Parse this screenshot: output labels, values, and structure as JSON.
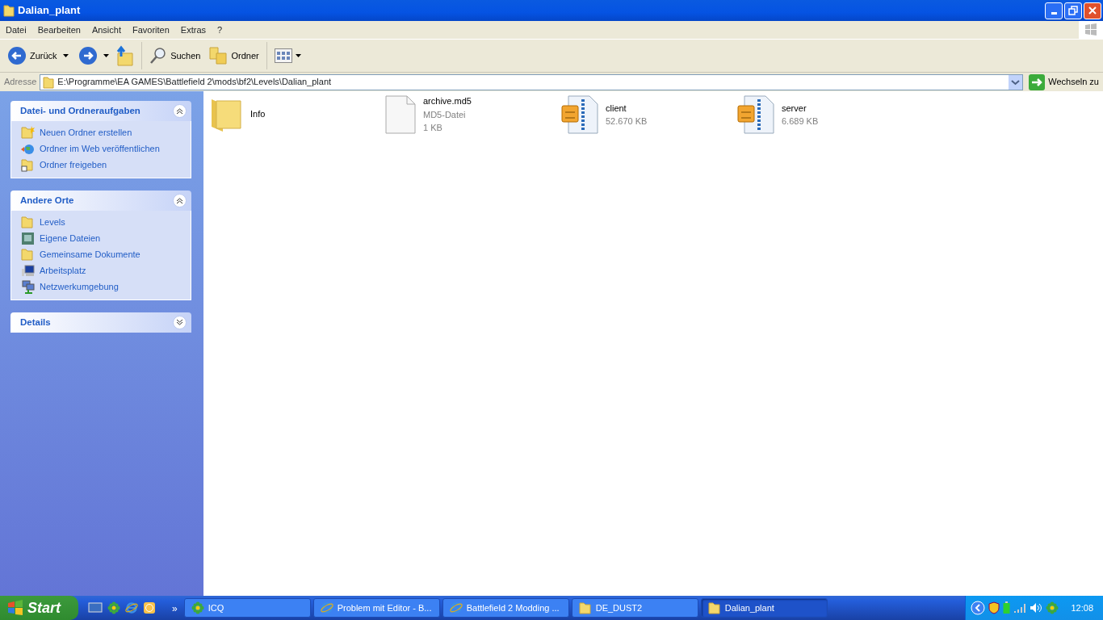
{
  "window": {
    "title": "Dalian_plant"
  },
  "menu": [
    "Datei",
    "Bearbeiten",
    "Ansicht",
    "Favoriten",
    "Extras",
    "?"
  ],
  "toolbar": {
    "back": "Zurück",
    "search": "Suchen",
    "folders": "Ordner"
  },
  "address": {
    "label": "Adresse",
    "value": "E:\\Programme\\EA GAMES\\Battlefield 2\\mods\\bf2\\Levels\\Dalian_plant",
    "go": "Wechseln zu"
  },
  "sidebar": [
    {
      "title": "Datei- und Ordneraufgaben",
      "expanded": true,
      "items": [
        "Neuen Ordner erstellen",
        "Ordner im Web veröffentlichen",
        "Ordner freigeben"
      ]
    },
    {
      "title": "Andere Orte",
      "expanded": true,
      "items": [
        "Levels",
        "Eigene Dateien",
        "Gemeinsame Dokumente",
        "Arbeitsplatz",
        "Netzwerkumgebung"
      ]
    },
    {
      "title": "Details",
      "expanded": false
    }
  ],
  "files": [
    {
      "kind": "folder",
      "name": "Info"
    },
    {
      "kind": "file",
      "name": "archive.md5",
      "type": "MD5-Datei",
      "size": "1 KB"
    },
    {
      "kind": "archive",
      "name": "client",
      "size": "52.670 KB"
    },
    {
      "kind": "archive",
      "name": "server",
      "size": "6.689 KB"
    }
  ],
  "taskbar": {
    "start": "Start",
    "more": "»",
    "buttons": [
      {
        "kind": "icq",
        "label": "ICQ",
        "selected": false
      },
      {
        "kind": "browser",
        "label": "Problem mit Editor - B...",
        "selected": false
      },
      {
        "kind": "browser",
        "label": "Battlefield 2 Modding ...",
        "selected": false
      },
      {
        "kind": "folder",
        "label": "DE_DUST2",
        "selected": false
      },
      {
        "kind": "folder",
        "label": "Dalian_plant",
        "selected": true
      }
    ],
    "clock": "12:08"
  }
}
